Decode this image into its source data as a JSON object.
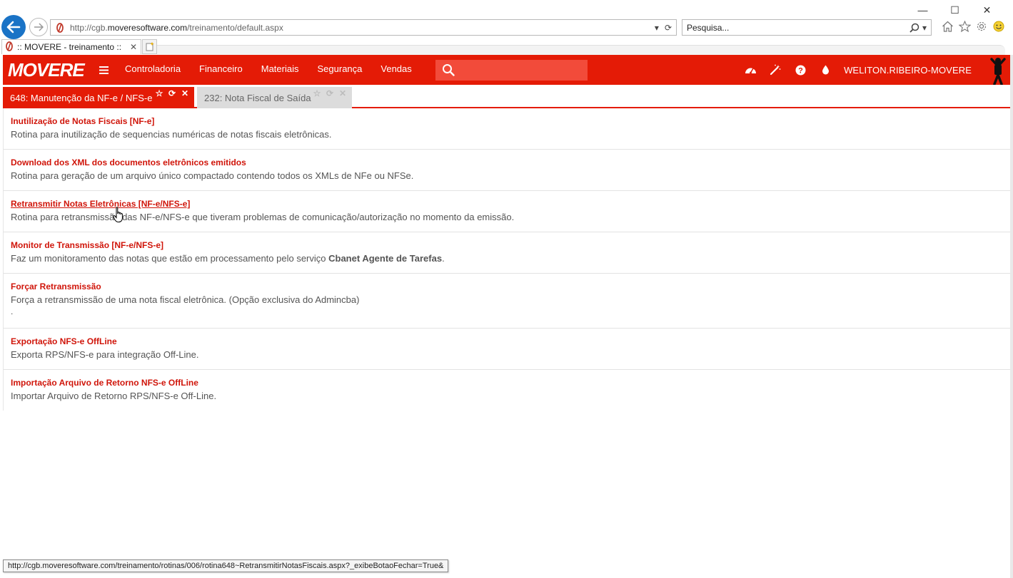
{
  "browser": {
    "url_prefix": "http://cgb.",
    "url_domain": "moveresoftware.com",
    "url_suffix": "/treinamento/default.aspx",
    "search_placeholder": "Pesquisa...",
    "tab_title": ":: MOVERE - treinamento ::",
    "tab_close": "✕",
    "window_minimize": "—",
    "window_maximize": "☐",
    "window_close": "✕"
  },
  "header": {
    "logo": "MOVERE",
    "nav": [
      "Controladoria",
      "Financeiro",
      "Materiais",
      "Segurança",
      "Vendas"
    ],
    "search_placeholder": "",
    "user": "WELITON.RIBEIRO-MOVERE",
    "brand_color": "#e41b06"
  },
  "rotina_tabs": [
    {
      "label": "648: Manutenção da NF-e / NFS-e",
      "active": true
    },
    {
      "label": "232: Nota Fiscal de Saída",
      "active": false
    }
  ],
  "items": [
    {
      "title": "Inutilização de Notas Fiscais [NF-e]",
      "desc": "Rotina para inutilização de sequencias numéricas de notas fiscais eletrônicas."
    },
    {
      "title": "Download dos XML dos documentos eletrônicos emitidos",
      "desc": "Rotina para geração de um arquivo único compactado contendo todos os XMLs de NFe ou NFSe."
    },
    {
      "title": "Retransmitir Notas Eletrônicas [NF-e/NFS-e]",
      "desc": "Rotina para retransmissão das NF-e/NFS-e que tiveram problemas de comunicação/autorização no momento da emissão."
    },
    {
      "title": "Monitor de Transmissão [NF-e/NFS-e]",
      "desc_before": "Faz um monitoramento das notas que estão em processamento pelo serviço ",
      "desc_bold": "Cbanet Agente de Tarefas",
      "desc_after": "."
    },
    {
      "title": "Forçar Retransmissão",
      "desc": "Força a retransmissão de uma nota fiscal eletrônica. (Opção exclusiva do Admincba)",
      "extra": "."
    },
    {
      "title": "Exportação NFS-e OffLine",
      "desc": "Exporta RPS/NFS-e para integração Off-Line."
    },
    {
      "title": "Importação Arquivo de Retorno NFS-e OffLine",
      "desc": "Importar Arquivo de Retorno RPS/NFS-e Off-Line."
    }
  ],
  "statusbar": {
    "url": "http://cgb.moveresoftware.com/treinamento/rotinas/006/rotina648~RetransmitirNotasFiscais.aspx?_exibeBotaoFechar=True&"
  }
}
